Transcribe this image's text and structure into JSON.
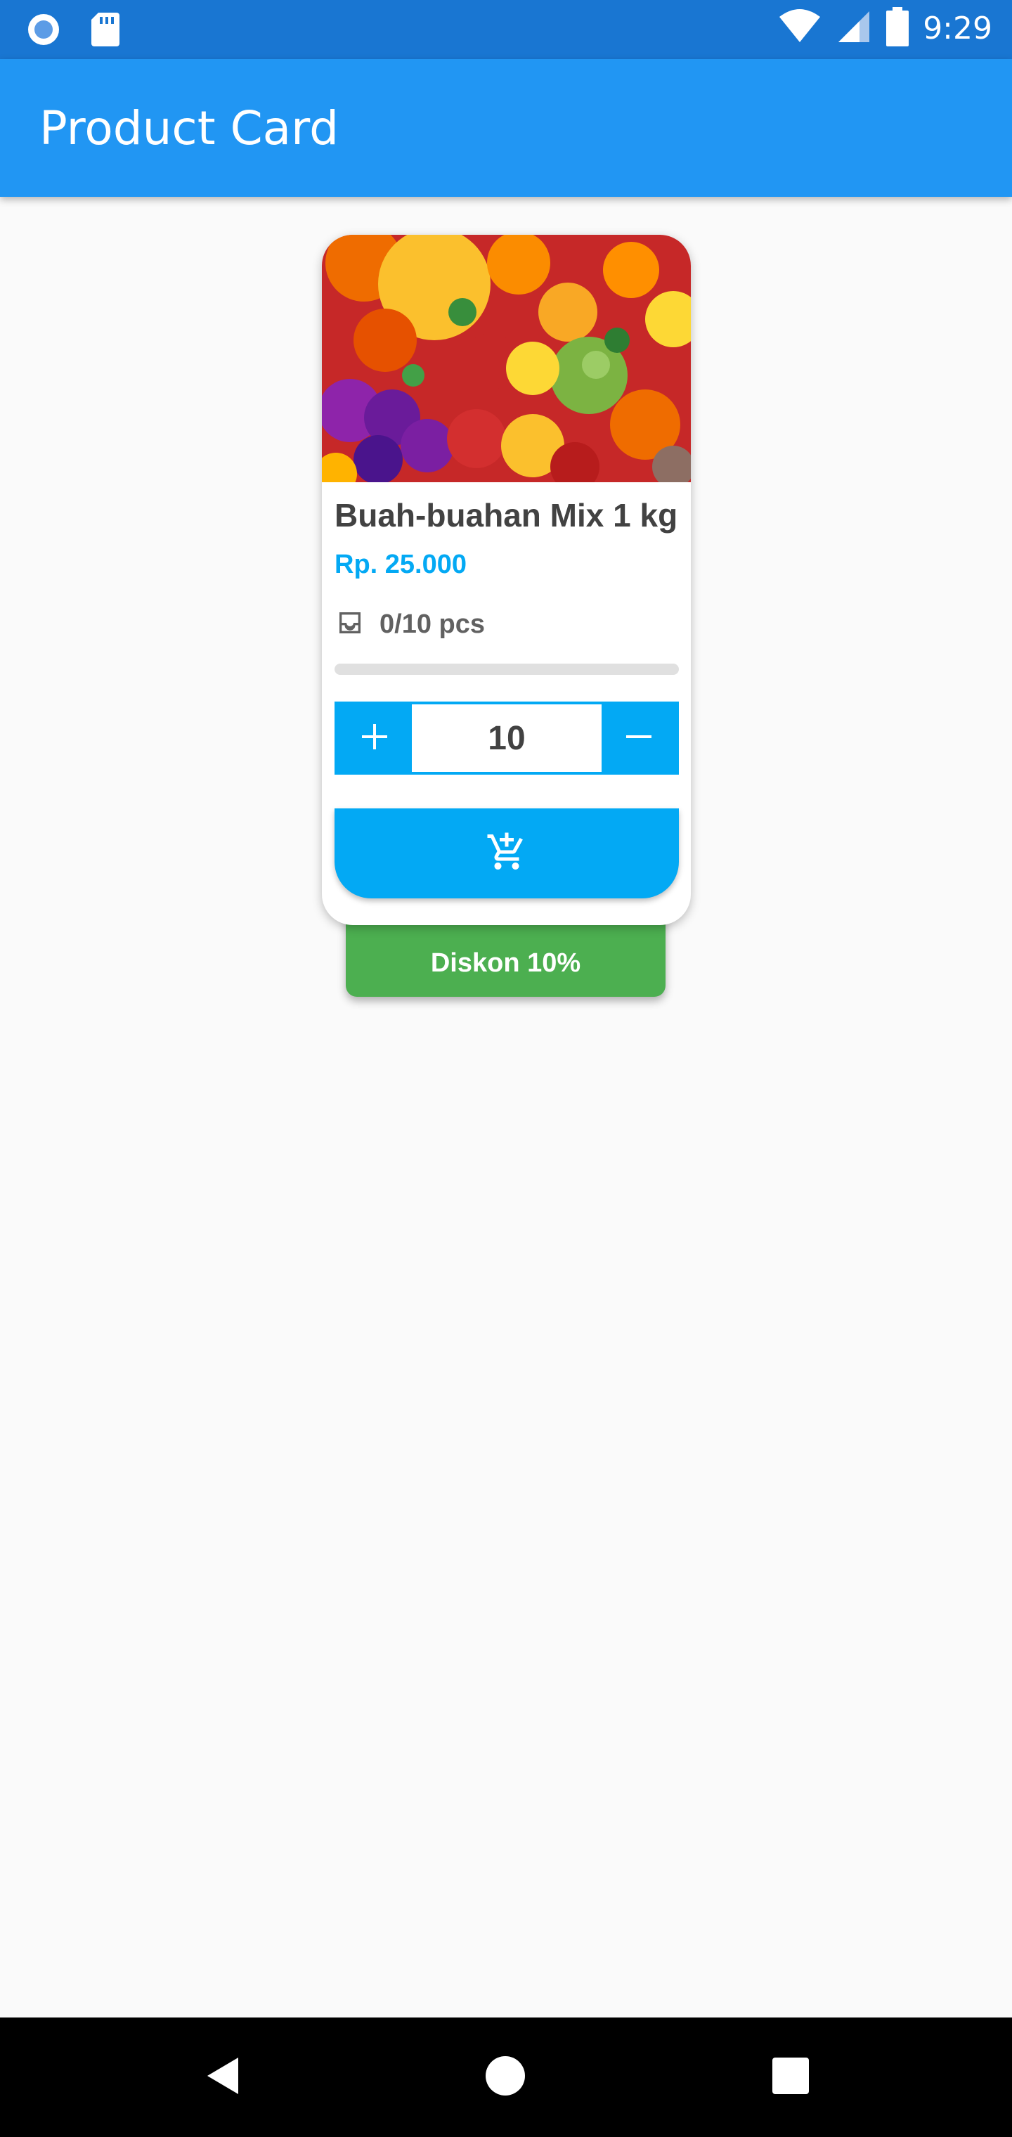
{
  "status_bar": {
    "time": "9:29",
    "icons": [
      "record-icon",
      "sd-card-icon",
      "wifi-icon",
      "cell-signal-icon",
      "battery-icon"
    ]
  },
  "app_bar": {
    "title": "Product Card",
    "color": "#2196f3"
  },
  "product": {
    "image": "fruit-assortment-image",
    "name": "Buah-buahan Mix 1 kg",
    "price": "Rp. 25.000",
    "stock_text": "0/10 pcs",
    "stock_progress": 0,
    "quantity": "10",
    "increment_symbol": "+",
    "decrement_symbol": "−",
    "cart_icon": "add-shopping-cart-icon",
    "discount": "Diskon 10%"
  },
  "colors": {
    "accent": "#03a9f4",
    "discount": "#4caf50"
  },
  "nav_bar": {
    "buttons": [
      "back-icon",
      "home-icon",
      "recents-icon"
    ]
  }
}
